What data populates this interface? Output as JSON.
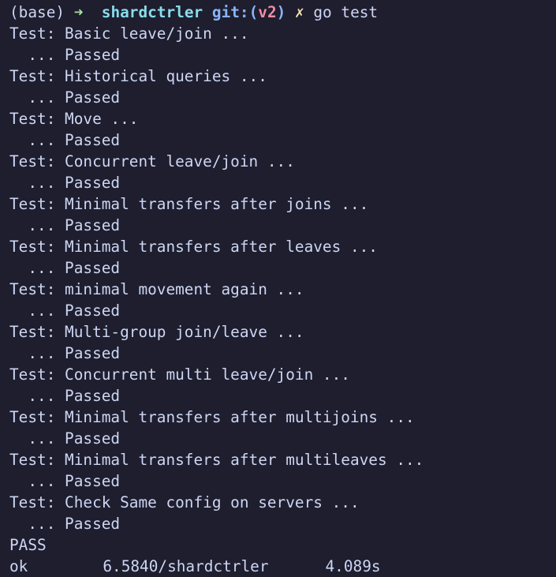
{
  "prompt": {
    "env": "(base)",
    "arrow": "➜",
    "dir": "shardctrler",
    "git_prefix": "git:(",
    "branch": "v2",
    "git_suffix": ")",
    "dirty": "✗",
    "command": "go test"
  },
  "tests": [
    {
      "label": "Test: Basic leave/join ...",
      "result": "  ... Passed"
    },
    {
      "label": "Test: Historical queries ...",
      "result": "  ... Passed"
    },
    {
      "label": "Test: Move ...",
      "result": "  ... Passed"
    },
    {
      "label": "Test: Concurrent leave/join ...",
      "result": "  ... Passed"
    },
    {
      "label": "Test: Minimal transfers after joins ...",
      "result": "  ... Passed"
    },
    {
      "label": "Test: Minimal transfers after leaves ...",
      "result": "  ... Passed"
    },
    {
      "label": "Test: minimal movement again ...",
      "result": "  ... Passed"
    },
    {
      "label": "Test: Multi-group join/leave ...",
      "result": "  ... Passed"
    },
    {
      "label": "Test: Concurrent multi leave/join ...",
      "result": "  ... Passed"
    },
    {
      "label": "Test: Minimal transfers after multijoins ...",
      "result": "  ... Passed"
    },
    {
      "label": "Test: Minimal transfers after multileaves ...",
      "result": "  ... Passed"
    },
    {
      "label": "Test: Check Same config on servers ...",
      "result": "  ... Passed"
    }
  ],
  "summary": {
    "pass": "PASS",
    "ok_line": "ok  \t6.5840/shardctrler\t4.089s",
    "ok": "ok",
    "package": "6.5840/shardctrler",
    "duration": "4.089s"
  },
  "colors": {
    "background": "#1e1e2e",
    "foreground": "#cdd6f4",
    "arrow": "#a6e3a1",
    "dir": "#89dceb",
    "git": "#89b4fa",
    "branch": "#f38ba8",
    "dirty": "#f9e2af"
  }
}
